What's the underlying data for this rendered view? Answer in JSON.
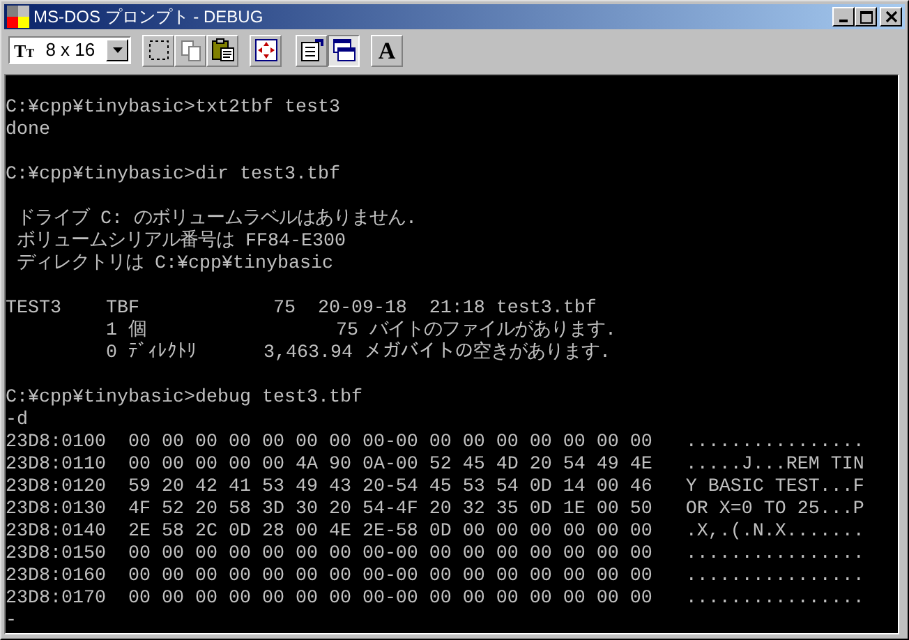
{
  "window": {
    "title": "MS-DOS プロンプト - DEBUG"
  },
  "toolbar": {
    "font_size": {
      "icon_glyphs": [
        "T",
        "T"
      ],
      "value": "8 x 16"
    },
    "buttons": [
      {
        "kind": "mark",
        "pressed": false
      },
      {
        "kind": "copy",
        "pressed": false
      },
      {
        "kind": "paste",
        "pressed": false
      },
      {
        "kind": "fullscreen",
        "pressed": false
      },
      {
        "kind": "properties",
        "pressed": false
      },
      {
        "kind": "background",
        "pressed": true
      },
      {
        "kind": "font",
        "pressed": false,
        "label": "A"
      }
    ]
  },
  "console": {
    "blocks": [
      [
        "C:¥cpp¥tinybasic>txt2tbf test3",
        "done"
      ],
      [
        "C:¥cpp¥tinybasic>dir test3.tbf"
      ],
      [
        " ドライブ C: のボリュームラベルはありません.",
        " ボリュームシリアル番号は FF84-E300",
        " ディレクトリは C:¥cpp¥tinybasic"
      ],
      [
        "TEST3    TBF            75  20-09-18  21:18 test3.tbf",
        "         1 個                 75 バイトのファイルがあります.",
        "         0 ﾃﾞｨﾚｸﾄﾘ      3,463.94 メガバイトの空きがあります."
      ],
      [
        "C:¥cpp¥tinybasic>debug test3.tbf",
        "-d",
        "23D8:0100  00 00 00 00 00 00 00 00-00 00 00 00 00 00 00 00   ................",
        "23D8:0110  00 00 00 00 00 4A 90 0A-00 52 45 4D 20 54 49 4E   .....J...REM TIN",
        "23D8:0120  59 20 42 41 53 49 43 20-54 45 53 54 0D 14 00 46   Y BASIC TEST...F",
        "23D8:0130  4F 52 20 58 3D 30 20 54-4F 20 32 35 0D 1E 00 50   OR X=0 TO 25...P",
        "23D8:0140  2E 58 2C 0D 28 00 4E 2E-58 0D 00 00 00 00 00 00   .X,.(.N.X.......",
        "23D8:0150  00 00 00 00 00 00 00 00-00 00 00 00 00 00 00 00   ................",
        "23D8:0160  00 00 00 00 00 00 00 00-00 00 00 00 00 00 00 00   ................",
        "23D8:0170  00 00 00 00 00 00 00 00-00 00 00 00 00 00 00 00   ................",
        "-"
      ]
    ]
  }
}
